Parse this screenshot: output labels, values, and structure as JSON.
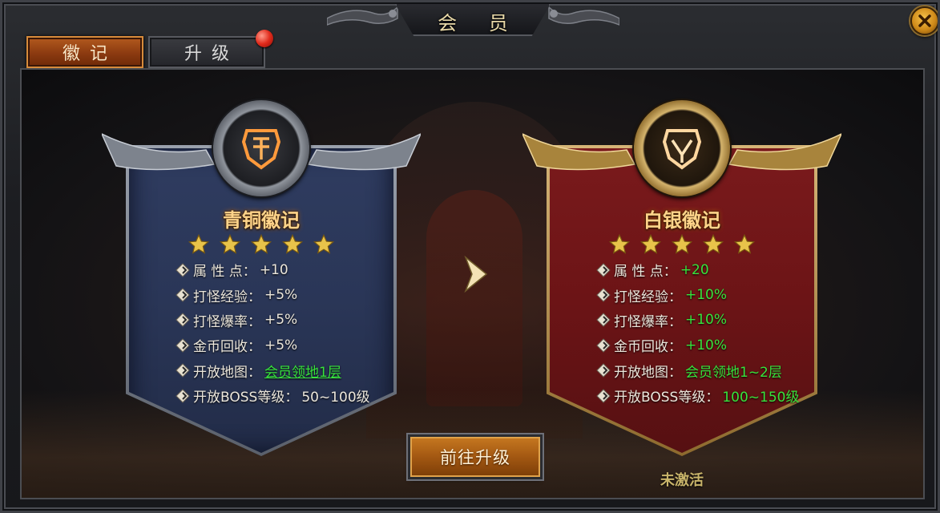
{
  "window": {
    "title": "会 员"
  },
  "tabs": [
    {
      "label": "徽记",
      "active": true
    },
    {
      "label": "升级",
      "active": false,
      "has_notification": true
    }
  ],
  "cards": {
    "bronze": {
      "title": "青铜徽记",
      "stars": 5,
      "stats": [
        {
          "label": "属 性 点：",
          "value": "+10"
        },
        {
          "label": "打怪经验：",
          "value": "+5%"
        },
        {
          "label": "打怪爆率：",
          "value": "+5%"
        },
        {
          "label": "金币回收：",
          "value": "+5%"
        },
        {
          "label": "开放地图：",
          "value": "会员领地1层"
        },
        {
          "label": "开放BOSS等级：",
          "value": "50~100级"
        }
      ]
    },
    "silver": {
      "title": "白银徽记",
      "stars": 5,
      "stats": [
        {
          "label": "属 性 点：",
          "value": "+20"
        },
        {
          "label": "打怪经验：",
          "value": "+10%"
        },
        {
          "label": "打怪爆率：",
          "value": "+10%"
        },
        {
          "label": "金币回收：",
          "value": "+10%"
        },
        {
          "label": "开放地图：",
          "value": "会员领地1~2层"
        },
        {
          "label": "开放BOSS等级：",
          "value": "100~150级"
        }
      ],
      "status": "未激活"
    }
  },
  "actions": {
    "goto_upgrade": "前往升级"
  },
  "colors": {
    "accent_orange": "#a35812",
    "highlight_green": "#37e33c",
    "title_gold": "#ffd48a",
    "bronze_banner": "#2a3657",
    "silver_banner": "#6c1416"
  },
  "icons": {
    "close": "close-icon",
    "star": "star-icon",
    "bullet": "diamond-bullet-icon",
    "arrow": "chevron-right-icon",
    "emblem": "shield-emblem-icon"
  }
}
